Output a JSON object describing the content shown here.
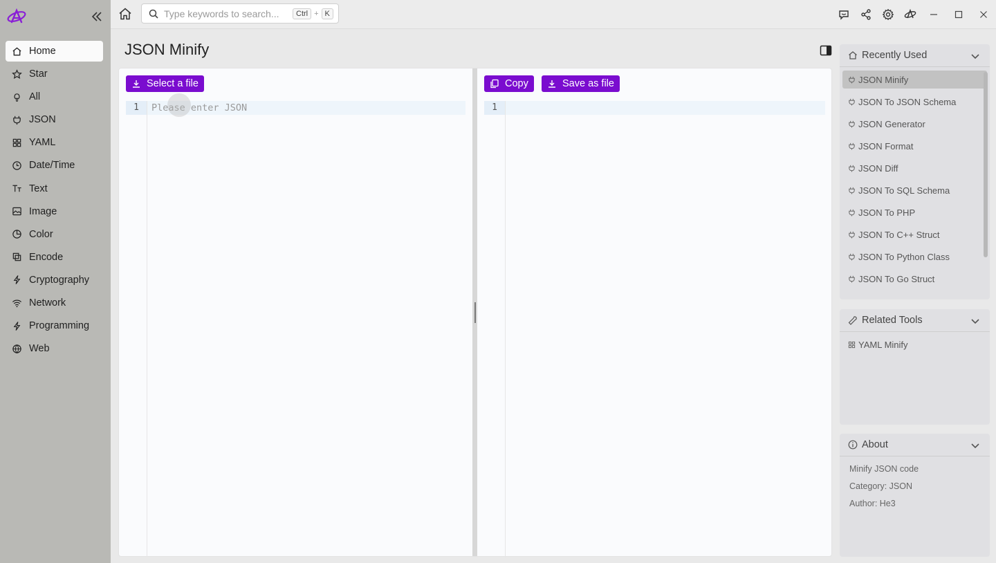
{
  "sidebar": {
    "items": [
      {
        "label": "Home",
        "icon": "home-icon"
      },
      {
        "label": "Star",
        "icon": "star-icon"
      },
      {
        "label": "All",
        "icon": "bulb-icon"
      },
      {
        "label": "JSON",
        "icon": "braces-icon"
      },
      {
        "label": "YAML",
        "icon": "grid-icon"
      },
      {
        "label": "Date/Time",
        "icon": "clock-icon"
      },
      {
        "label": "Text",
        "icon": "text-icon"
      },
      {
        "label": "Image",
        "icon": "image-icon"
      },
      {
        "label": "Color",
        "icon": "palette-icon"
      },
      {
        "label": "Encode",
        "icon": "copy-icon"
      },
      {
        "label": "Cryptography",
        "icon": "bolt-icon"
      },
      {
        "label": "Network",
        "icon": "wifi-icon"
      },
      {
        "label": "Programming",
        "icon": "bolt-icon"
      },
      {
        "label": "Web",
        "icon": "globe-icon"
      }
    ]
  },
  "topbar": {
    "search_placeholder": "Type keywords to search...",
    "shortcut_ctrl": "Ctrl",
    "shortcut_plus": "+",
    "shortcut_key": "K"
  },
  "page": {
    "title": "JSON Minify"
  },
  "editor": {
    "select_file_label": "Select a file",
    "copy_label": "Copy",
    "save_label": "Save as file",
    "input_line_no": "1",
    "output_line_no": "1",
    "input_placeholder": "Please enter JSON"
  },
  "recently_used": {
    "title": "Recently Used",
    "items": [
      "JSON Minify",
      "JSON To JSON Schema",
      "JSON Generator",
      "JSON Format",
      "JSON Diff",
      "JSON To SQL Schema",
      "JSON To PHP",
      "JSON To C++ Struct",
      "JSON To Python Class",
      "JSON To Go Struct"
    ]
  },
  "related_tools": {
    "title": "Related Tools",
    "items": [
      "YAML Minify"
    ]
  },
  "about": {
    "title": "About",
    "description": "Minify JSON code",
    "category": "Category: JSON",
    "author": "Author: He3"
  },
  "colors": {
    "accent": "#7a0ccf",
    "sidebar_bg": "#b9b9b5"
  }
}
